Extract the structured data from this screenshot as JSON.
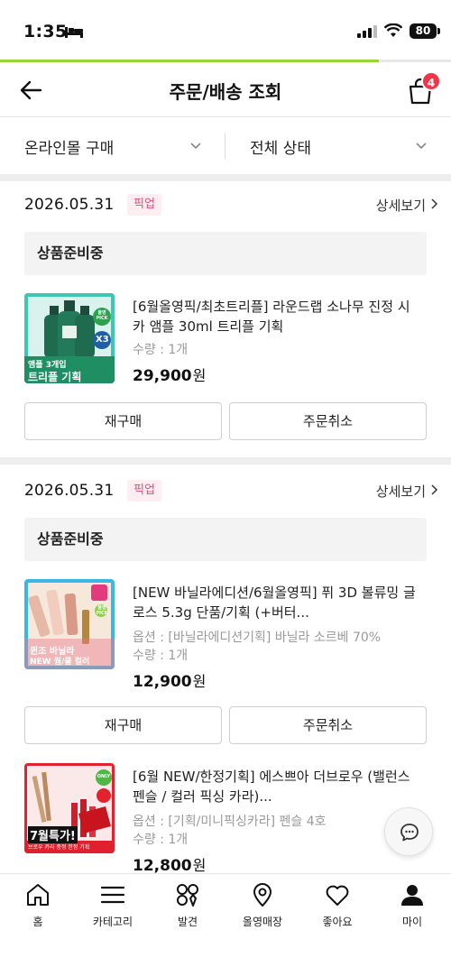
{
  "status_bar": {
    "time": "1:35",
    "battery": "80"
  },
  "header": {
    "title": "주문/배송 조회",
    "cart_count": "4"
  },
  "filters": {
    "left": "온라인몰 구매",
    "right": "전체 상태"
  },
  "orders": [
    {
      "date": "2026.05.31",
      "chip": "픽업",
      "detail": "상세보기",
      "status": "상품준비중",
      "products": [
        {
          "name": "[6월올영픽/최초트리플] 라운드랩 소나무 진정 시카 앰플 30ml 트리플 기획",
          "qty": "수량 : 1개",
          "price": "29,900",
          "price_unit": "원",
          "thumb_text": [
            "앰플 3개입",
            "트리플 기획"
          ],
          "thumb_badge": "X3",
          "thumb_sticker": "올영 PICK"
        }
      ],
      "buttons": {
        "reorder": "재구매",
        "cancel": "주문취소"
      }
    },
    {
      "date": "2026.05.31",
      "chip": "픽업",
      "detail": "상세보기",
      "status": "상품준비중",
      "products": [
        {
          "name": "[NEW 바닐라에디션/6월올영픽] 퓌 3D 볼류밍 글로스 5.3g 단품/기획 (+버터...",
          "option": "옵션 : [바닐라에디션기획] 바닐라 소르베 70%",
          "qty": "수량 : 1개",
          "price": "12,900",
          "price_unit": "원",
          "thumb_text": [
            "퀸조 바닐라",
            "NEW 웜/쿨 컬러"
          ],
          "thumb_sticker": "올영 PICK"
        },
        {
          "name": "[6월 NEW/한정기획] 에스쁘아 더브로우 (밸런스 펜슬 / 컬러 픽싱 카라)...",
          "option": "옵션 : [기획/미니픽싱카라] 펜슬 4호",
          "qty": "수량 : 1개",
          "price": "12,800",
          "price_unit": "원",
          "thumb_text": [
            "7월특가!",
            "브로우 카라 증정 한정 기획"
          ],
          "thumb_sticker": "ONLY"
        }
      ],
      "buttons": {
        "reorder": "재구매",
        "cancel": "주문취소"
      }
    }
  ],
  "bottom_nav": [
    {
      "label": "홈",
      "icon": "home-icon"
    },
    {
      "label": "카테고리",
      "icon": "menu-icon"
    },
    {
      "label": "발견",
      "icon": "discover-icon"
    },
    {
      "label": "올영매장",
      "icon": "location-pin-icon"
    },
    {
      "label": "좋아요",
      "icon": "heart-icon"
    },
    {
      "label": "마이",
      "icon": "person-icon"
    }
  ],
  "colors": {
    "accent_green": "#9cd23b",
    "badge_red": "#f0344a",
    "pickup_pink": "#e84a7a"
  }
}
